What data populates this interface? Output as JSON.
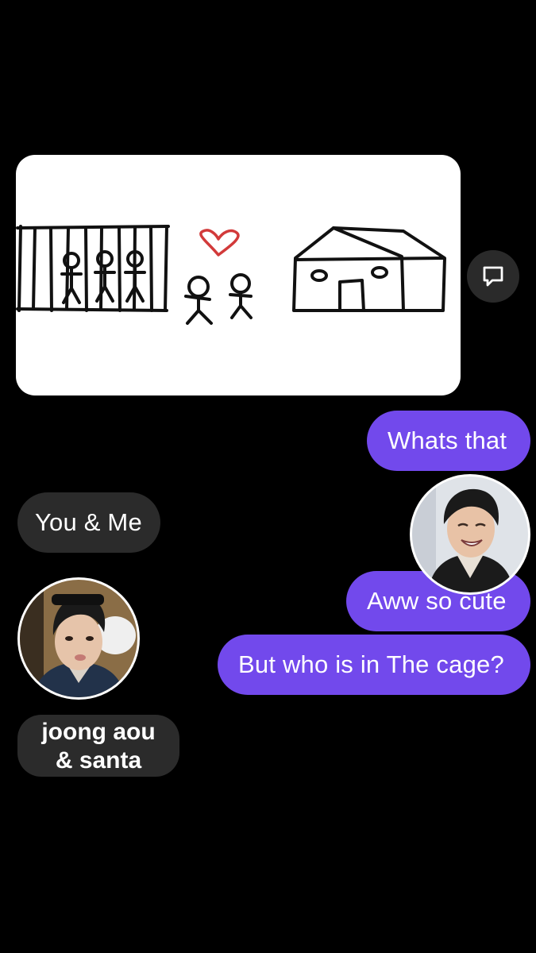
{
  "messages": {
    "image_message": {
      "alt": "drawing"
    },
    "whats_that": "Whats that",
    "you_and_me": "You & Me",
    "aww_so_cute": "Aww so cute",
    "who_in_cage": "But who is in The cage?"
  },
  "caption": {
    "line1": "joong aou",
    "line2": "& santa"
  },
  "icons": {
    "reply": "reply-bubble-icon",
    "heart": "heart-icon"
  },
  "colors": {
    "background": "#000000",
    "sent_bubble": "#7249ec",
    "received_bubble": "#2b2b2b",
    "heart": "#d23a3a"
  }
}
